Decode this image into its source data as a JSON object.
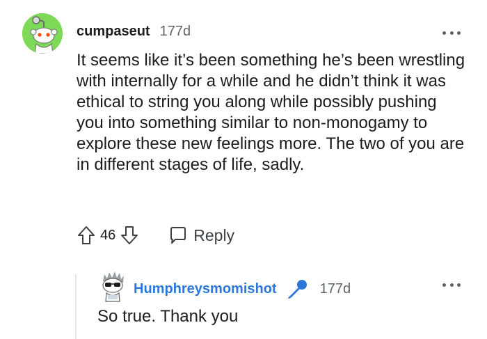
{
  "comment": {
    "username": "cumpaseut",
    "timestamp": "177d",
    "avatar_icon": "snoo-avatar-icon",
    "avatar_color": "#7ed957",
    "body": "It seems like it’s been something he’s been wrestling with internally for a while and he didn’t think it was ethical to string you along while possibly pushing you into something similar to non-monogamy to explore these new feelings more. The two of you are in different stages of life, sadly.",
    "more_icon": "more-options-icon",
    "actions": {
      "upvote_icon": "upvote-arrow-icon",
      "vote_count": "46",
      "downvote_icon": "downvote-arrow-icon",
      "reply_icon": "reply-bubble-icon",
      "reply_label": "Reply"
    }
  },
  "reply": {
    "username": "Humphreysmomishot",
    "username_color": "#2d77d8",
    "flair_icon": "microphone-icon",
    "flair_color": "#2d77d8",
    "timestamp": "177d",
    "avatar_icon": "snoo-sunglasses-avatar-icon",
    "body": "So true. Thank you",
    "more_icon": "more-options-icon"
  }
}
